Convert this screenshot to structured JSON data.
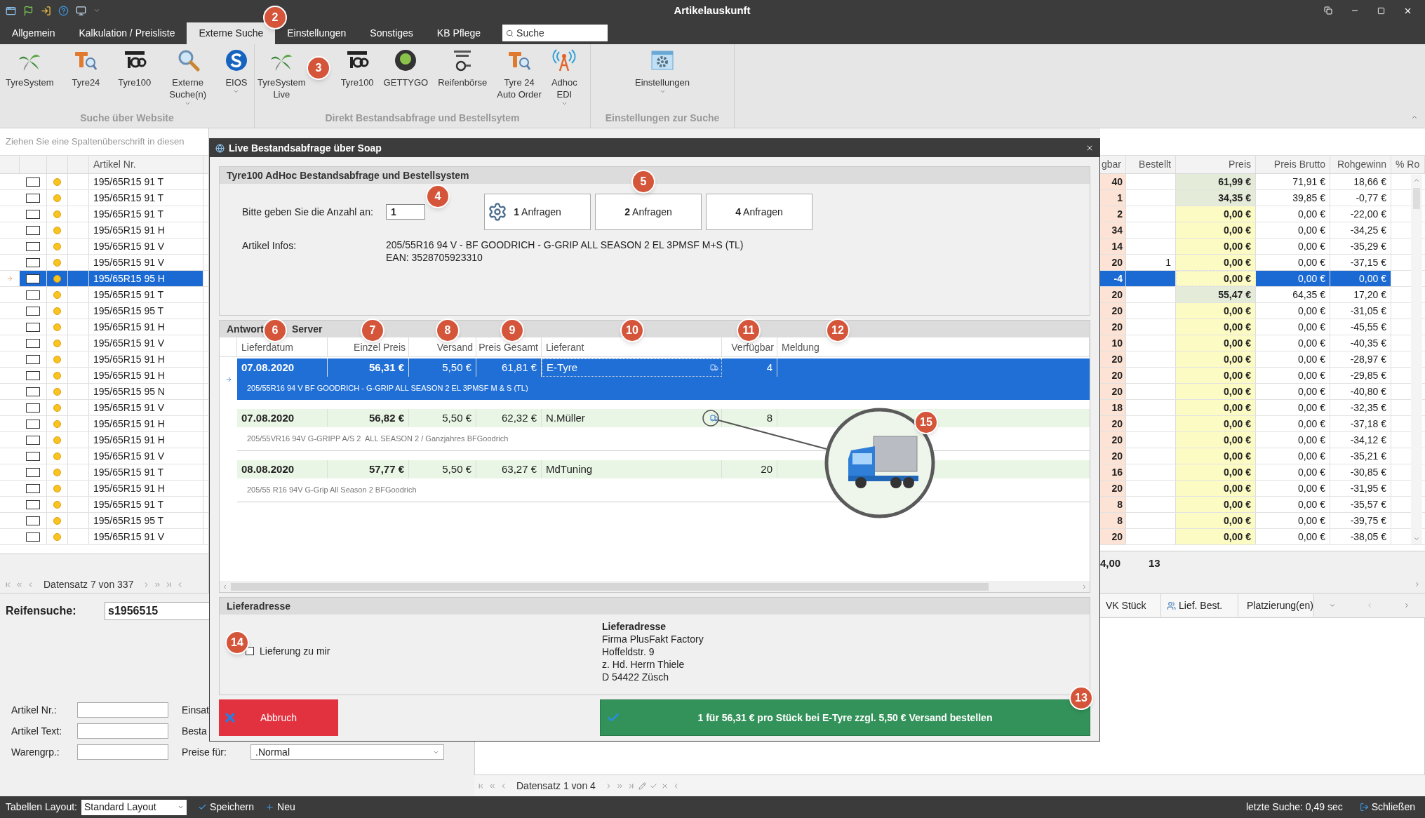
{
  "window": {
    "title": "Artikelauskunft"
  },
  "ribbon_tabs": [
    {
      "label": "Allgemein",
      "selected": false
    },
    {
      "label": "Kalkulation / Preisliste",
      "selected": false
    },
    {
      "label": "Externe Suche",
      "selected": true
    },
    {
      "label": "Einstellungen",
      "selected": false
    },
    {
      "label": "Sonstiges",
      "selected": false
    },
    {
      "label": "KB Pflege",
      "selected": false
    }
  ],
  "ribbon_search": {
    "placeholder": "Suche"
  },
  "ribbon_groups": [
    {
      "title": "Suche über Website",
      "buttons": [
        {
          "kind": "palm",
          "lines": [
            "TyreSystem"
          ],
          "dropdown": false
        },
        {
          "kind": "t24",
          "lines": [
            "Tyre24"
          ],
          "dropdown": false
        },
        {
          "kind": "tyre100",
          "lines": [
            "Tyre100"
          ],
          "dropdown": false
        },
        {
          "kind": "magnifier",
          "lines": [
            "Externe",
            "Suche(n)"
          ],
          "dropdown": true
        },
        {
          "kind": "eios",
          "lines": [
            "EIOS"
          ],
          "dropdown": true
        }
      ]
    },
    {
      "title": "Direkt Bestandsabfrage und Bestellsytem",
      "buttons": [
        {
          "kind": "palm",
          "lines": [
            "TyreSystem",
            "Live"
          ],
          "dropdown": false
        },
        {
          "kind": "tyre100",
          "lines": [
            "Tyre100"
          ],
          "dropdown": false
        },
        {
          "kind": "gettygo",
          "lines": [
            "GETTYGO"
          ],
          "dropdown": false
        },
        {
          "kind": "reifenboerse",
          "lines": [
            "Reifenbörse"
          ],
          "dropdown": false
        },
        {
          "kind": "t24",
          "lines": [
            "Tyre 24",
            "Auto Order"
          ],
          "dropdown": false
        },
        {
          "kind": "antenna",
          "lines": [
            "Adhoc",
            "EDI"
          ],
          "dropdown": true
        }
      ]
    },
    {
      "title": "Einstellungen zur Suche",
      "buttons": [
        {
          "kind": "settings",
          "lines": [
            "Einstellungen"
          ],
          "dropdown": true
        }
      ]
    }
  ],
  "grid": {
    "group_hint": "Ziehen Sie eine Spaltenüberschrift in diesen",
    "left_columns": [
      "Artikel Nr."
    ],
    "right_columns": [
      "gbar",
      "Bestellt",
      "Preis",
      "Preis Brutto",
      "Rohgewinn",
      "% Ro"
    ],
    "rows": [
      {
        "artikel": "195/65R15 91 T",
        "checked": false,
        "selected": false,
        "verfuegbar": "40",
        "preis": "61,99 €",
        "color": "#e4ebd9",
        "brutto": "71,91 €",
        "rohgewinn": "18,66 €"
      },
      {
        "artikel": "195/65R15 91 T",
        "checked": false,
        "selected": false,
        "verfuegbar": "1",
        "preis": "34,35 €",
        "color": "#e4ebd9",
        "brutto": "39,85 €",
        "rohgewinn": "-0,77 €"
      },
      {
        "artikel": "195/65R15 91 T",
        "checked": false,
        "selected": false,
        "verfuegbar": "2",
        "preis": "0,00 €",
        "color": "#fdfbc4",
        "brutto": "0,00 €",
        "rohgewinn": "-22,00 €"
      },
      {
        "artikel": "195/65R15 91 H",
        "checked": false,
        "selected": false,
        "verfuegbar": "34",
        "preis": "0,00 €",
        "color": "#fdfbc4",
        "brutto": "0,00 €",
        "rohgewinn": "-34,25 €"
      },
      {
        "artikel": "195/65R15 91 V",
        "checked": false,
        "selected": false,
        "verfuegbar": "14",
        "preis": "0,00 €",
        "color": "#fdfbc4",
        "brutto": "0,00 €",
        "rohgewinn": "-35,29 €"
      },
      {
        "artikel": "195/65R15 91 V",
        "checked": false,
        "selected": false,
        "verfuegbar": "20",
        "bestellt": "1",
        "preis": "0,00 €",
        "color": "#fdfbc4",
        "brutto": "0,00 €",
        "rohgewinn": "-37,15 €"
      },
      {
        "artikel": "195/65R15 95 H",
        "checked": false,
        "selected": true,
        "verfuegbar": "-4",
        "preis": "0,00 €",
        "color": "#fdfbc4",
        "brutto": "0,00 €",
        "rohgewinn": "0,00 €"
      },
      {
        "artikel": "195/65R15 91 T",
        "checked": false,
        "selected": false,
        "verfuegbar": "20",
        "preis": "55,47 €",
        "color": "#e4ebd9",
        "brutto": "64,35 €",
        "rohgewinn": "17,20 €"
      },
      {
        "artikel": "195/65R15 95 T",
        "checked": false,
        "selected": false,
        "verfuegbar": "20",
        "preis": "0,00 €",
        "color": "#fdfbc4",
        "brutto": "0,00 €",
        "rohgewinn": "-31,05 €"
      },
      {
        "artikel": "195/65R15 91 H",
        "checked": false,
        "selected": false,
        "verfuegbar": "20",
        "preis": "0,00 €",
        "color": "#fdfbc4",
        "brutto": "0,00 €",
        "rohgewinn": "-45,55 €"
      },
      {
        "artikel": "195/65R15 91 V",
        "checked": false,
        "selected": false,
        "verfuegbar": "10",
        "preis": "0,00 €",
        "color": "#fdfbc4",
        "brutto": "0,00 €",
        "rohgewinn": "-40,35 €"
      },
      {
        "artikel": "195/65R15 91 H",
        "checked": false,
        "selected": false,
        "verfuegbar": "20",
        "preis": "0,00 €",
        "color": "#fdfbc4",
        "brutto": "0,00 €",
        "rohgewinn": "-28,97 €"
      },
      {
        "artikel": "195/65R15 91 H",
        "checked": false,
        "selected": false,
        "verfuegbar": "20",
        "preis": "0,00 €",
        "color": "#fdfbc4",
        "brutto": "0,00 €",
        "rohgewinn": "-29,85 €"
      },
      {
        "artikel": "195/65R15 95 N",
        "checked": false,
        "selected": false,
        "verfuegbar": "20",
        "preis": "0,00 €",
        "color": "#fdfbc4",
        "brutto": "0,00 €",
        "rohgewinn": "-40,80 €"
      },
      {
        "artikel": "195/65R15 91 V",
        "checked": false,
        "selected": false,
        "verfuegbar": "18",
        "preis": "0,00 €",
        "color": "#fdfbc4",
        "brutto": "0,00 €",
        "rohgewinn": "-32,35 €"
      },
      {
        "artikel": "195/65R15 91 H",
        "checked": false,
        "selected": false,
        "verfuegbar": "20",
        "preis": "0,00 €",
        "color": "#fdfbc4",
        "brutto": "0,00 €",
        "rohgewinn": "-37,18 €"
      },
      {
        "artikel": "195/65R15 91 H",
        "checked": false,
        "selected": false,
        "verfuegbar": "20",
        "preis": "0,00 €",
        "color": "#fdfbc4",
        "brutto": "0,00 €",
        "rohgewinn": "-34,12 €"
      },
      {
        "artikel": "195/65R15 91 V",
        "checked": false,
        "selected": false,
        "verfuegbar": "20",
        "preis": "0,00 €",
        "color": "#fdfbc4",
        "brutto": "0,00 €",
        "rohgewinn": "-35,21 €"
      },
      {
        "artikel": "195/65R15 91 T",
        "checked": false,
        "selected": false,
        "verfuegbar": "16",
        "preis": "0,00 €",
        "color": "#fdfbc4",
        "brutto": "0,00 €",
        "rohgewinn": "-30,85 €"
      },
      {
        "artikel": "195/65R15 91 H",
        "checked": false,
        "selected": false,
        "verfuegbar": "20",
        "preis": "0,00 €",
        "color": "#fdfbc4",
        "brutto": "0,00 €",
        "rohgewinn": "-31,95 €"
      },
      {
        "artikel": "195/65R15 91 T",
        "checked": false,
        "selected": false,
        "verfuegbar": "8",
        "preis": "0,00 €",
        "color": "#fdfbc4",
        "brutto": "0,00 €",
        "rohgewinn": "-35,57 €"
      },
      {
        "artikel": "195/65R15 95 T",
        "checked": false,
        "selected": false,
        "verfuegbar": "8",
        "preis": "0,00 €",
        "color": "#fdfbc4",
        "brutto": "0,00 €",
        "rohgewinn": "-39,75 €"
      },
      {
        "artikel": "195/65R15 91 V",
        "checked": false,
        "selected": false,
        "verfuegbar": "20",
        "preis": "0,00 €",
        "color": "#fdfbc4",
        "brutto": "0,00 €",
        "rohgewinn": "-38,05 €"
      }
    ],
    "summary": [
      "4,00",
      "13"
    ],
    "nav": "Datensatz 7 von 337"
  },
  "search": {
    "label": "Reifensuche:",
    "value": "s1956515"
  },
  "filters": [
    {
      "label": "Artikel Nr.:",
      "label_2": "Einsat"
    },
    {
      "label": "Artikel Text:",
      "label_2": "Besta"
    }
  ],
  "price_filter": {
    "label": "Warengrp.:",
    "label_2": "Preise für:",
    "value": ".Normal"
  },
  "detail_tabs": [
    "VK Stück",
    "Lief. Best.",
    "Platzierung(en)"
  ],
  "detail_nav": "Datensatz 1 von 4",
  "status_bar": {
    "layout_label": "Tabellen Layout:",
    "layout_value": "Standard Layout",
    "save": "Speichern",
    "new": "Neu",
    "last_search": "letzte Suche: 0,49 sec",
    "close": "Schließen"
  },
  "dialog": {
    "title": "Live Bestandsabfrage über Soap",
    "query": {
      "title": "Tyre100 AdHoc Bestandsabfrage und Bestellsystem",
      "quantity_label": "Bitte geben Sie die Anzahl an:",
      "quantity": "1",
      "buttons": [
        {
          "label": "**1** Anfragen",
          "icon": true
        },
        {
          "label": "**2** Anfragen",
          "icon": false
        },
        {
          "label": "**4** Anfragen",
          "icon": false
        }
      ],
      "info_label": "Artikel Infos:",
      "info_lines": [
        "205/55R16 94 V - BF GOODRICH - G-GRIP ALL SEASON 2 EL 3PMSF M+S (TL)",
        "EAN: 3528705923310"
      ]
    },
    "results": {
      "title_parts": [
        "Antwort",
        "Server"
      ],
      "columns": [
        "Lieferdatum",
        "Einzel Preis",
        "Versand",
        "Preis Gesamt",
        "Lieferant",
        "Verfügbar",
        "Meldung"
      ],
      "rows": [
        {
          "date": "07.08.2020",
          "unit_price": "56,31 €",
          "shipping": "5,50 €",
          "total": "61,81 €",
          "supplier": "E-Tyre",
          "available": "4",
          "description": "205/55R16 94 V BF GOODRICH - G-GRIP ALL SEASON 2 EL 3PMSF M & S (TL)",
          "selected": true,
          "truck_icon": true
        },
        {
          "date": "07.08.2020",
          "unit_price": "56,82 €",
          "shipping": "5,50 €",
          "total": "62,32 €",
          "supplier": "N.Müller",
          "available": "8",
          "description": "205/55VR16 94V G-GRIPP A/S 2  ALL SEASON 2 / Ganzjahres BFGoodrich",
          "selected": false,
          "truck_icon": true
        },
        {
          "date": "08.08.2020",
          "unit_price": "57,77 €",
          "shipping": "5,50 €",
          "total": "63,27 €",
          "supplier": "MdTuning",
          "available": "20",
          "description": "205/55 R16 94V G-Grip All Season 2 BFGoodrich",
          "selected": false,
          "truck_icon": false
        }
      ]
    },
    "address": {
      "title": "Lieferadresse",
      "deliver_to_me": {
        "label": "Lieferung zu mir",
        "checked": false
      },
      "heading": "Lieferadresse",
      "lines": [
        "Firma PlusFakt Factory",
        "Hoffeldstr. 9",
        "z. Hd. Herrn Thiele",
        "D 54422 Züsch"
      ]
    },
    "cancel": "Abbruch",
    "order": "1 für 56,31 € pro Stück bei E-Tyre zzgl. 5,50 € Versand bestellen"
  },
  "callouts": [
    "2",
    "3",
    "4",
    "5",
    "6",
    "7",
    "8",
    "9",
    "10",
    "11",
    "12",
    "13",
    "14",
    "15"
  ]
}
